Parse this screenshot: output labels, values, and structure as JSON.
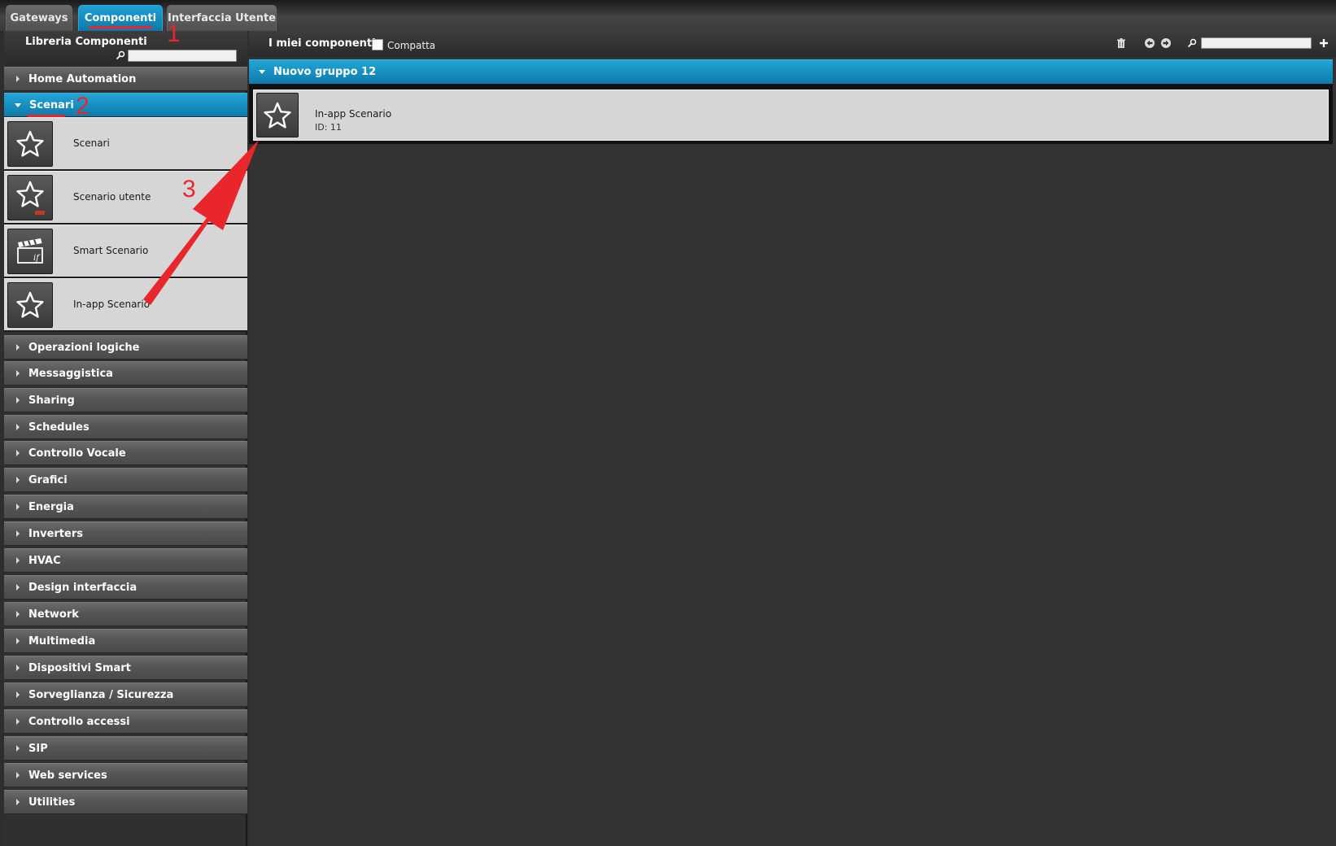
{
  "tabs": [
    {
      "label": "Gateways",
      "active": false
    },
    {
      "label": "Componenti",
      "active": true
    },
    {
      "label": "Interfaccia Utente",
      "active": false
    }
  ],
  "library": {
    "title": "Libreria Componenti",
    "search_value": "",
    "categories_before": [
      {
        "label": "Home Automation"
      }
    ],
    "open_category": {
      "label": "Scenari",
      "items": [
        {
          "label": "Scenari",
          "icon": "star-icon"
        },
        {
          "label": "Scenario utente",
          "icon": "star-user-icon"
        },
        {
          "label": "Smart Scenario",
          "icon": "clapperboard-icon"
        },
        {
          "label": "In-app Scenario",
          "icon": "star-icon"
        }
      ]
    },
    "categories_after": [
      {
        "label": "Operazioni logiche"
      },
      {
        "label": "Messaggistica"
      },
      {
        "label": "Sharing"
      },
      {
        "label": "Schedules"
      },
      {
        "label": "Controllo Vocale"
      },
      {
        "label": "Grafici"
      },
      {
        "label": "Energia"
      },
      {
        "label": "Inverters"
      },
      {
        "label": "HVAC"
      },
      {
        "label": "Design interfaccia"
      },
      {
        "label": "Network"
      },
      {
        "label": "Multimedia"
      },
      {
        "label": "Dispositivi Smart"
      },
      {
        "label": "Sorveglianza / Sicurezza"
      },
      {
        "label": "Controllo accessi"
      },
      {
        "label": "SIP"
      },
      {
        "label": "Web services"
      },
      {
        "label": "Utilities"
      }
    ]
  },
  "my_components": {
    "title": "I miei componenti",
    "compact_label": "Compatta",
    "compact_checked": false,
    "search_value": "",
    "toolbar_icons": [
      "trash-icon",
      "arrow-left-circle-icon",
      "arrow-right-circle-icon",
      "search-icon",
      "plus-icon"
    ],
    "group": {
      "label": "Nuovo gruppo 12",
      "items": [
        {
          "name": "In-app Scenario",
          "id_text": "ID: 11",
          "icon": "star-icon"
        }
      ]
    }
  },
  "annotations": {
    "step1": "1",
    "step2": "2",
    "step3": "3",
    "color": "#e8262c"
  },
  "colors": {
    "accent": "#1591c4",
    "background": "#2e2e2e",
    "item_background": "#d6d6d6"
  }
}
